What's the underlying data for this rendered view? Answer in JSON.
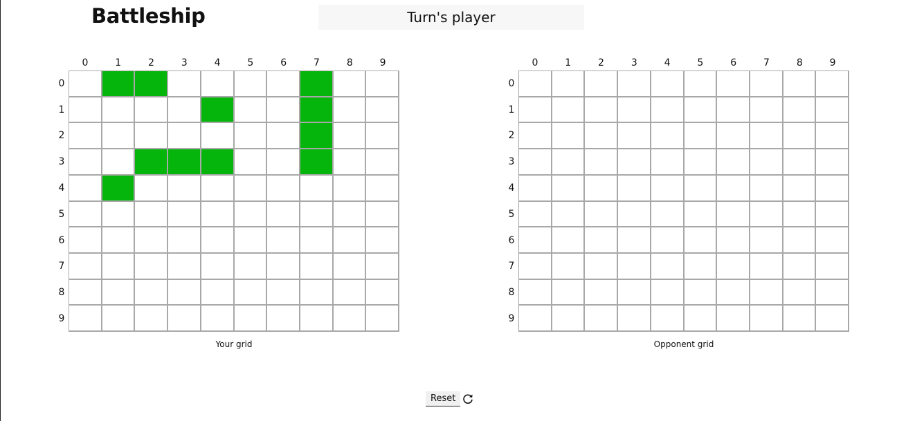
{
  "header": {
    "title": "Battleship",
    "turn_text": "Turn's player"
  },
  "colors": {
    "ship": "#05b50b",
    "grid_line": "#a8a8a8",
    "turn_box_bg": "#f7f7f7"
  },
  "boards": {
    "player": {
      "caption": "Your grid",
      "columns": [
        "0",
        "1",
        "2",
        "3",
        "4",
        "5",
        "6",
        "7",
        "8",
        "9"
      ],
      "rows": [
        "0",
        "1",
        "2",
        "3",
        "4",
        "5",
        "6",
        "7",
        "8",
        "9"
      ],
      "ships": [
        [
          0,
          1
        ],
        [
          0,
          2
        ],
        [
          0,
          7
        ],
        [
          1,
          4
        ],
        [
          1,
          7
        ],
        [
          2,
          7
        ],
        [
          3,
          2
        ],
        [
          3,
          3
        ],
        [
          3,
          4
        ],
        [
          3,
          7
        ],
        [
          4,
          1
        ]
      ]
    },
    "opponent": {
      "caption": "Opponent grid",
      "columns": [
        "0",
        "1",
        "2",
        "3",
        "4",
        "5",
        "6",
        "7",
        "8",
        "9"
      ],
      "rows": [
        "0",
        "1",
        "2",
        "3",
        "4",
        "5",
        "6",
        "7",
        "8",
        "9"
      ],
      "ships": []
    }
  },
  "controls": {
    "reset_label": "Reset",
    "reset_icon": "refresh-icon"
  }
}
